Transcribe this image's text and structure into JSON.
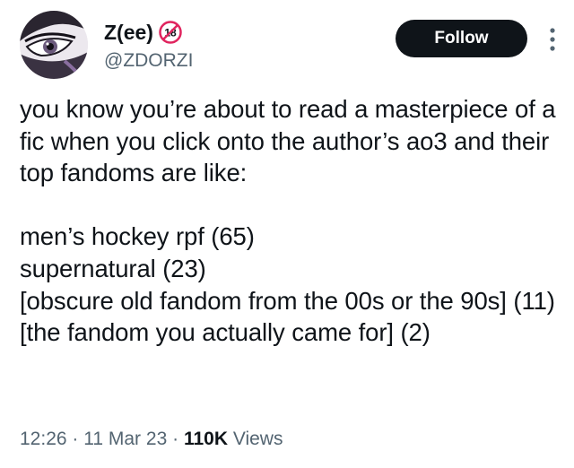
{
  "author": {
    "display_name": "Z(ee)",
    "handle": "@ZDORZI",
    "age_badge_text": "18"
  },
  "actions": {
    "follow_label": "Follow"
  },
  "tweet": {
    "intro": "you know you’re about to read a masterpiece of a fic when you click onto the author’s ao3 and their top fandoms are like:",
    "list": "men’s hockey rpf (65)\nsupernatural (23)\n[obscure old fandom from the 00s or the 90s] (11)\n[the fandom you actually came for] (2)"
  },
  "meta": {
    "time": "12:26",
    "separator": "·",
    "date": "11 Mar 23",
    "views_count": "110K",
    "views_label": "Views"
  },
  "colors": {
    "text": "#0f1419",
    "secondary": "#536471",
    "button_bg": "#0f1419",
    "badge_red": "#e0245e"
  },
  "icons": {
    "more": "more-vertical-icon",
    "age": "age-18-badge-icon"
  }
}
